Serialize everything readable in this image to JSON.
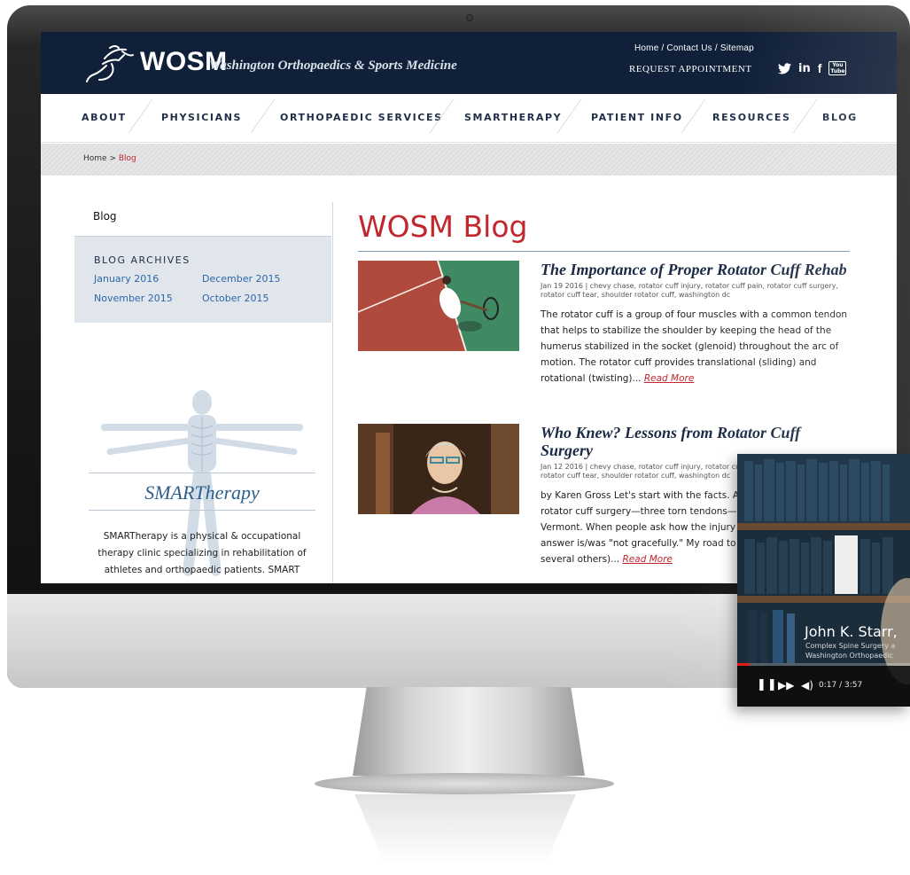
{
  "site": {
    "logo_text": "WOSM",
    "tagline": "Washington Orthopaedics & Sports Medicine",
    "util_links": [
      "Home",
      "Contact Us",
      "Sitemap"
    ],
    "util_sep": " / ",
    "request_appointment": "REQUEST APPOINTMENT",
    "social_icons": [
      "twitter-icon",
      "linkedin-icon",
      "facebook-icon",
      "youtube-icon"
    ],
    "youtube_text_top": "You",
    "youtube_text_bottom": "Tube"
  },
  "nav": {
    "items": [
      "ABOUT",
      "PHYSICIANS",
      "ORTHOPAEDIC SERVICES",
      "SMARTHERAPY",
      "PATIENT INFO",
      "RESOURCES",
      "BLOG"
    ]
  },
  "breadcrumb": {
    "home": "Home",
    "sep": " > ",
    "current": "Blog"
  },
  "sidebar": {
    "title": "Blog",
    "archives_heading": "BLOG ARCHIVES",
    "archives": [
      "January 2016",
      "December 2015",
      "November 2015",
      "October 2015"
    ],
    "promo_title": "SMARTherapy",
    "promo_text": "SMARTherapy is a physical & occupational therapy clinic specializing in rehabilitation of athletes and orthopaedic patients. SMART"
  },
  "main": {
    "heading": "WOSM Blog",
    "posts": [
      {
        "title": "The Importance of Proper Rotator Cuff Rehab",
        "meta": "Jan 19 2016  |  chevy chase, rotator cuff injury, rotator cuff pain, rotator cuff surgery, rotator cuff tear, shoulder rotator cuff, washington dc",
        "excerpt": "The rotator cuff is a group of four muscles with a common tendon that helps to stabilize the shoulder by keeping the head of the humerus stabilized in the socket (glenoid) throughout the arc of motion. The rotator cuff provides translational (sliding) and rotational (twisting)... ",
        "read_more": "Read More"
      },
      {
        "title": "Who Knew? Lessons from Rotator Cuff Surgery",
        "meta": "Jan 12 2016  |  chevy chase, rotator cuff injury, rotator cuff pain, rotator cuff surgery, rotator cuff tear, shoulder rotator cuff, washington dc",
        "excerpt": "by Karen Gross Let's start with the facts. A few years ago I had rotator cuff surgery—three torn tendons—at a small hospital in Vermont. When people ask how the injury happened, my standard answer is/was \"not gracefully.\" My road to recovery (after visiting several others)... ",
        "read_more": "Read More"
      }
    ]
  },
  "video": {
    "name": "John K. Starr,",
    "subtitle_1": "Complex Spine Surgery a",
    "subtitle_2": "Washington Orthopaedic",
    "time": "0:17 / 3:57",
    "progress": 0.072
  }
}
